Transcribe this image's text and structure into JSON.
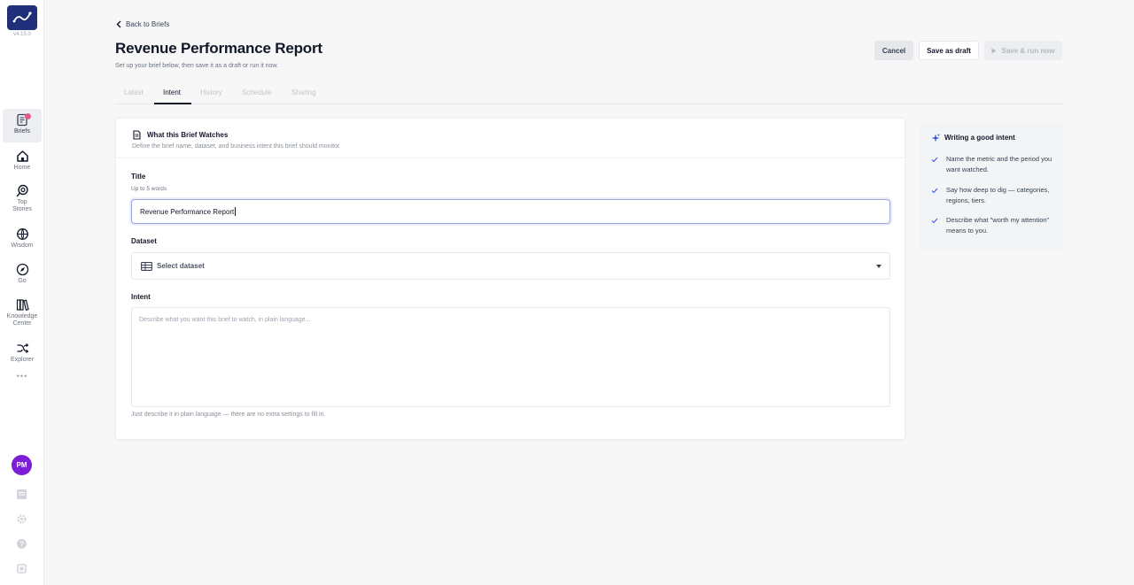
{
  "app": {
    "version": "v4.15.0"
  },
  "sidebar": {
    "items": [
      {
        "label": "Briefs",
        "icon": "briefs-icon",
        "active": true
      },
      {
        "label": "Home",
        "icon": "home-icon"
      },
      {
        "label": "Top Stories",
        "icon": "top-stories-icon"
      },
      {
        "label": "Wisdom",
        "icon": "wisdom-icon"
      },
      {
        "label": "Go",
        "icon": "compass-icon"
      },
      {
        "label": "Knowledge Center",
        "icon": "library-icon"
      },
      {
        "label": "Explorer",
        "icon": "shuffle-icon"
      }
    ],
    "more": "•••",
    "avatar_initials": "PM"
  },
  "header": {
    "back_label": "Back to Briefs",
    "title": "Revenue Performance Report",
    "subtitle": "Set up your brief below, then save it as a draft or run it now.",
    "cancel_label": "Cancel",
    "draft_label": "Save as draft",
    "run_label": "Save & run now"
  },
  "tabs": [
    {
      "label": "Latest",
      "active": false
    },
    {
      "label": "Intent",
      "active": true
    },
    {
      "label": "History",
      "active": false
    },
    {
      "label": "Schedule",
      "active": false
    },
    {
      "label": "Sharing",
      "active": false
    }
  ],
  "card": {
    "title": "What this Brief Watches",
    "subtitle": "Define the brief name, dataset, and business intent this brief should monitor.",
    "title_field": {
      "label": "Title",
      "hint": "Up to 5 words",
      "value": "Revenue Performance Report"
    },
    "dataset_field": {
      "label": "Dataset",
      "placeholder": "Select dataset"
    },
    "intent_field": {
      "label": "Intent",
      "placeholder": "Describe what you want this brief to watch, in plain language...",
      "footer": "Just describe it in plain language — there are no extra settings to fill in."
    }
  },
  "tips": {
    "title": "Writing a good intent",
    "items": [
      "Name the metric and the period you want watched.",
      "Say how deep to dig — categories, regions, tiers.",
      "Describe what \"worth my attention\" means to you."
    ]
  },
  "colors": {
    "brand": "#1f2f7a",
    "avatar": "#7b1fd6",
    "focus": "#9aa6dc",
    "tip_accent": "#3b5bdb"
  }
}
